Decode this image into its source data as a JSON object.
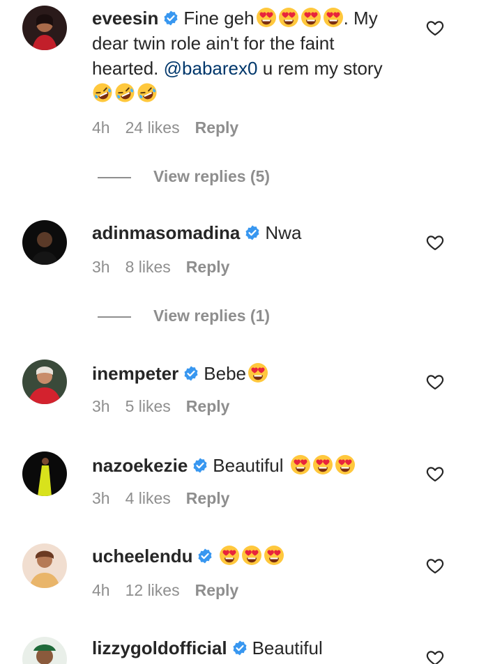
{
  "colors": {
    "text": "#262626",
    "muted": "#8e8e8e",
    "mention": "#00376b",
    "verified": "#3897f0"
  },
  "icons": {
    "verified": "verified-badge-icon",
    "like": "heart-icon",
    "heart_eyes": "heart-eyes-emoji",
    "rofl": "rolling-laughing-emoji"
  },
  "comments": [
    {
      "username": "eveesin",
      "text_a": "Fine geh",
      "text_b": ". My",
      "text_line2": "dear twin role ain't for the faint",
      "text_line3_a": "hearted.",
      "mention": "@babarex0",
      "text_line3_b": "u rem my story",
      "time": "4h",
      "likes": "24 likes",
      "reply": "Reply",
      "view_replies": "View replies (5)"
    },
    {
      "username": "adinmasomadina",
      "text": "Nwa",
      "time": "3h",
      "likes": "8 likes",
      "reply": "Reply",
      "view_replies": "View replies (1)"
    },
    {
      "username": "inempeter",
      "text": "Bebe",
      "time": "3h",
      "likes": "5 likes",
      "reply": "Reply"
    },
    {
      "username": "nazoekezie",
      "text": "Beautiful",
      "time": "3h",
      "likes": "4 likes",
      "reply": "Reply"
    },
    {
      "username": "ucheelendu",
      "text": "",
      "time": "4h",
      "likes": "12 likes",
      "reply": "Reply"
    },
    {
      "username": "lizzygoldofficial",
      "text": "Beautiful"
    }
  ]
}
